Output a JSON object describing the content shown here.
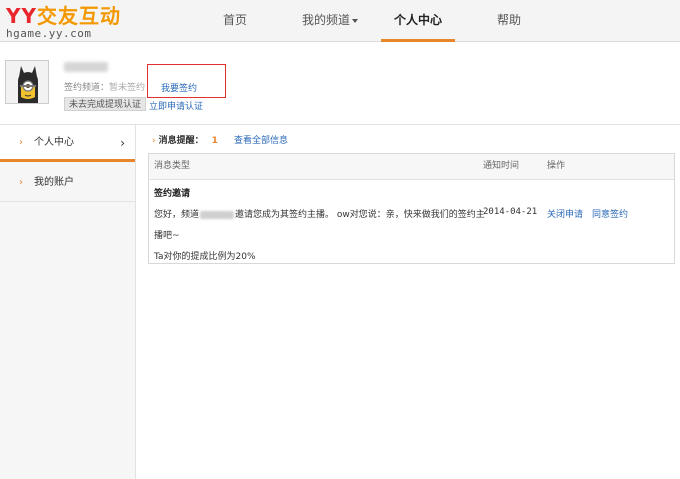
{
  "header": {
    "logo_main_yy": "YY",
    "logo_main_cn": "交友互动",
    "logo_sub": "hgame.yy.com",
    "nav": {
      "home": "首页",
      "channel": "我的频道",
      "center": "个人中心",
      "help": "帮助"
    }
  },
  "profile": {
    "sign_label": "签约频道：",
    "sign_value": "暂未签约",
    "apply_link": "我要签约",
    "verify_badge": "未去完成提现认证",
    "verify_link": "立即申请认证"
  },
  "sidebar": {
    "items": [
      {
        "label": "个人中心",
        "active": true
      },
      {
        "label": "我的账户",
        "active": false
      }
    ]
  },
  "messages": {
    "header_marker": "›",
    "header_title": "消息提醒：",
    "count": "1",
    "view_all": "查看全部信息",
    "columns": {
      "type": "消息类型",
      "time": "通知时间",
      "op": "操作"
    },
    "rows": [
      {
        "title": "签约邀请",
        "text_before": "您好，频道",
        "text_after": "邀请您成为其签约主播。 ow对您说：亲，快来做我们的签约主",
        "text_line2": "播吧~",
        "text_line3": "Ta对你的提成比例为20%",
        "date": "2014-04-21",
        "close_label": "关闭申请",
        "agree_label": "同意签约"
      }
    ]
  },
  "colors": {
    "accent": "#e8862b",
    "link": "#2a6ab9",
    "logo_red": "#e8262c",
    "logo_orange": "#f39800",
    "highlight_box": "#e03030"
  },
  "icons": {
    "avatar": "batman-avatar",
    "nav_caret": "caret-down-icon",
    "side_chevron": "chevron-right-icon"
  }
}
